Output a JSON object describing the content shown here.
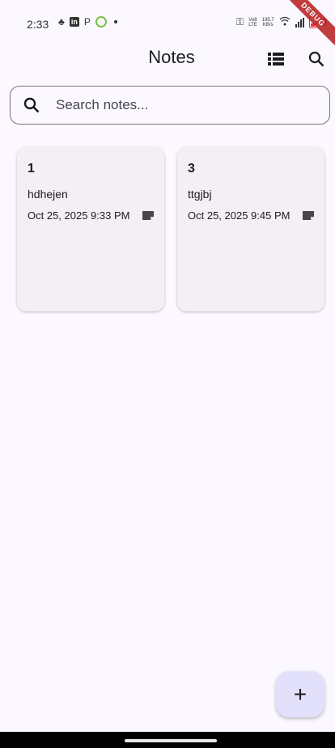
{
  "status_bar": {
    "time": "2:33",
    "left_icons": [
      "snapchat-icon",
      "linkedin-icon",
      "pinterest-icon",
      "rec-icon",
      "dot-icon"
    ],
    "data_speed": "195.7",
    "data_unit": "KB/s",
    "volte_label": "Vo8",
    "lte_label": "LTE",
    "battery_label": "9",
    "debug_banner": "DEBUG"
  },
  "app_bar": {
    "title": "Notes"
  },
  "search": {
    "placeholder": "Search notes..."
  },
  "notes": [
    {
      "title": "1",
      "body": "hdhejen",
      "date": "Oct 25, 2025 9:33 PM",
      "icon": "note-icon"
    },
    {
      "title": "3",
      "body": "ttgjbj",
      "date": "Oct 25, 2025 9:45 PM",
      "icon": "note-icon"
    }
  ],
  "fab": {
    "label": "+"
  },
  "colors": {
    "background": "#fbf8ff",
    "card": "#f3eff5",
    "fab": "#e3e0fb",
    "debug": "#b71c1c"
  }
}
